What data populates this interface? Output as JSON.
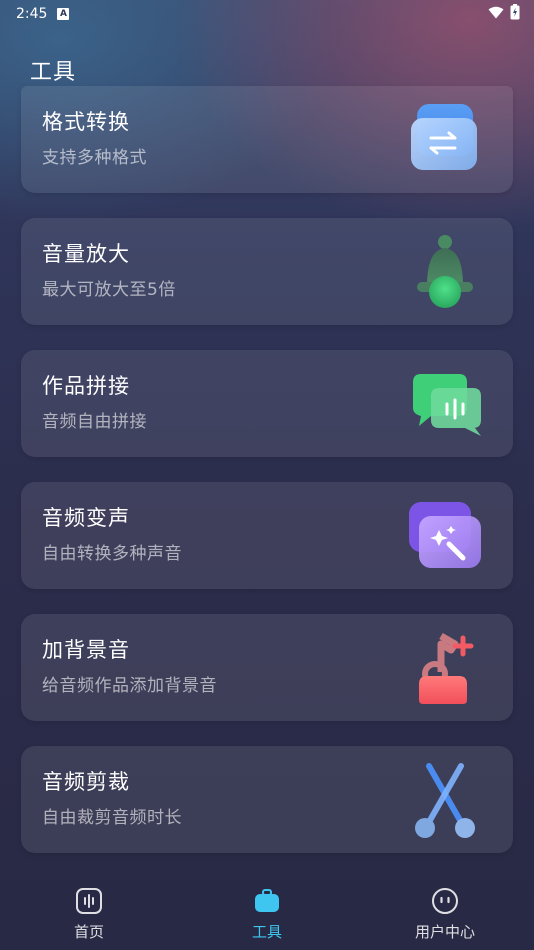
{
  "status_bar": {
    "time": "2:45",
    "notification_glyph": "A",
    "icons": [
      "wifi-icon",
      "battery-icon"
    ]
  },
  "page": {
    "title": "工具"
  },
  "tools": [
    {
      "name": "格式转换",
      "desc": "支持多种格式",
      "icon": "convert-icon"
    },
    {
      "name": "音量放大",
      "desc": "最大可放大至5倍",
      "icon": "bell-icon"
    },
    {
      "name": "作品拼接",
      "desc": "音频自由拼接",
      "icon": "chat-bubbles-icon"
    },
    {
      "name": "音频变声",
      "desc": "自由转换多种声音",
      "icon": "magic-wand-icon"
    },
    {
      "name": "加背景音",
      "desc": "给音频作品添加背景音",
      "icon": "music-note-plus-icon"
    },
    {
      "name": "音频剪裁",
      "desc": "自由裁剪音频时长",
      "icon": "scissors-icon"
    }
  ],
  "nav": {
    "items": [
      {
        "label": "首页",
        "icon": "home-waveform-icon",
        "active": false
      },
      {
        "label": "工具",
        "icon": "toolbox-icon",
        "active": true
      },
      {
        "label": "用户中心",
        "icon": "user-face-icon",
        "active": false
      }
    ],
    "active_color": "#3ec6f0"
  }
}
